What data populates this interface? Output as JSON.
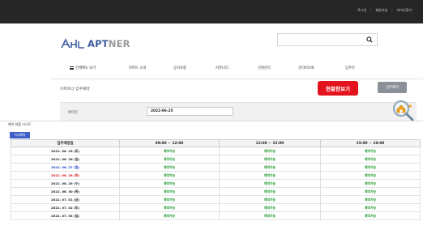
{
  "topbar": {
    "links": [
      "로그인",
      "회원가입",
      "아이디찾기"
    ]
  },
  "logo": {
    "text_main": "APT",
    "text_sub": "NER"
  },
  "search": {
    "placeholder": ""
  },
  "gnb": {
    "items": [
      "전체메뉴 보기",
      "아파트 소개",
      "공지사항",
      "커뮤니티",
      "민원관리",
      "관리비조회",
      "입주민"
    ]
  },
  "page": {
    "title": "아파트너 입주예약"
  },
  "buttons": {
    "view_status": "현황판보기",
    "reserve": "입주예약"
  },
  "date_filter": {
    "label": "예약일",
    "value": "2022-06-25"
  },
  "section": {
    "label": "예약 현황 리스트"
  },
  "badge": {
    "label": "이사예약"
  },
  "table": {
    "headers": [
      "입주예정일",
      "09:00 ~ 12:00",
      "12:00 ~ 15:00",
      "15:00 ~ 18:00"
    ],
    "rows": [
      {
        "date": "2022. 06. 25 (토)",
        "kind": "normal",
        "slots": [
          "예약가능",
          "예약가능",
          "예약가능"
        ]
      },
      {
        "date": "2022. 06. 26 (일)",
        "kind": "normal",
        "slots": [
          "예약가능",
          "예약가능",
          "예약가능"
        ]
      },
      {
        "date": "2022. 06. 27 (월)",
        "kind": "blue",
        "slots": [
          "예약가능",
          "예약가능",
          "예약가능"
        ]
      },
      {
        "date": "2022. 06. 28 (화)",
        "kind": "red",
        "slots": [
          "예약가능",
          "예약가능",
          "예약가능"
        ]
      },
      {
        "date": "2022. 06. 29 (수)",
        "kind": "normal",
        "slots": [
          "예약가능",
          "예약가능",
          "예약가능"
        ]
      },
      {
        "date": "2022. 06. 30 (목)",
        "kind": "normal",
        "slots": [
          "예약가능",
          "예약가능",
          "예약가능"
        ]
      },
      {
        "date": "2022. 07. 01 (금)",
        "kind": "normal",
        "slots": [
          "예약가능",
          "예약가능",
          "예약가능"
        ]
      },
      {
        "date": "2022. 07. 02 (토)",
        "kind": "normal",
        "slots": [
          "예약가능",
          "예약가능",
          "예약가능"
        ]
      },
      {
        "date": "2022. 07. 03 (일)",
        "kind": "normal",
        "slots": [
          "예약가능",
          "예약가능",
          "예약가능"
        ]
      }
    ]
  },
  "colors": {
    "topbar": "#262626",
    "brand": "#3f5b9f",
    "accent_red": "#e4121d",
    "available_green": "#1f9a2d",
    "badge_blue": "#3f5fc7"
  }
}
